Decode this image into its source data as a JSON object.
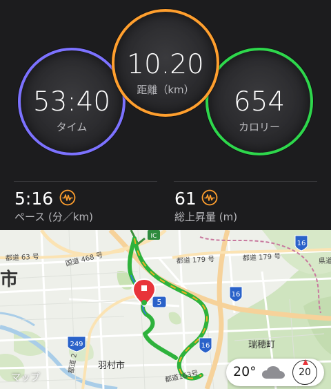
{
  "rings": {
    "time": {
      "value": "53:40",
      "label": "タイム",
      "color": "#7c72ff"
    },
    "distance": {
      "value": "10.20",
      "label": "距離（km）",
      "color": "#ff9f2e"
    },
    "calories": {
      "value": "654",
      "label": "カロリー",
      "color": "#2ed74c"
    }
  },
  "stats": {
    "pace": {
      "value": "5:16",
      "label": "ペース (分／km)",
      "icon": "heart-rate-wave-icon"
    },
    "elevation": {
      "value": "61",
      "label": "総上昇量 (m)",
      "icon": "heart-rate-wave-icon"
    }
  },
  "map": {
    "labels": {
      "city_left": "市",
      "route63": "都道 63 号",
      "route468": "国道 468 号",
      "route179": "都道 179 号",
      "route163": "都道163号",
      "hamura": "羽村市",
      "mizuho": "瑞穂町",
      "pref_road": "県道",
      "todo2": "都道 2",
      "ic": "IC"
    },
    "shields": {
      "s5": "5",
      "s16a": "16",
      "s16b": "16",
      "s16c": "16",
      "s249": "249"
    },
    "attribution": " マップ",
    "weather": {
      "temperature": "20°",
      "icon": "cloud-icon"
    },
    "compass": {
      "value": "20"
    }
  },
  "colors": {
    "background": "#1c1c1e",
    "accent_orange": "#ff9f2e",
    "map_background": "#eef0ea"
  }
}
